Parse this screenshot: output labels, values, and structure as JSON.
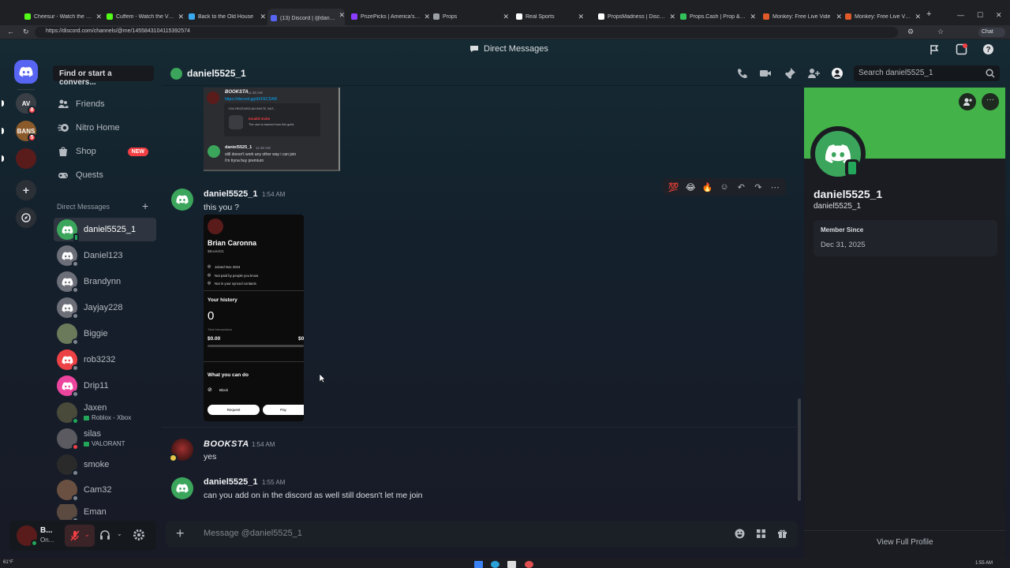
{
  "browser": {
    "tabs": [
      {
        "label": "Cheesur - Watch the VOD o",
        "color": "#53fc18"
      },
      {
        "label": "Cuffem - Watch the VOD on",
        "color": "#53fc18"
      },
      {
        "label": "Back to the Old House",
        "color": "#3aa8f0"
      },
      {
        "label": "(13) Discord | @daniel5525",
        "color": "#5865f2"
      },
      {
        "label": "PrizePicks | America's #1 Fan",
        "color": "#8b3dff"
      },
      {
        "label": "Props",
        "color": "#9aa0a6"
      },
      {
        "label": "Real Sports",
        "color": "#ffffff"
      },
      {
        "label": "PropsMadness | Discover N",
        "color": "#ffffff"
      },
      {
        "label": "Props.Cash | Prop & Pick Fi",
        "color": "#33c15a"
      },
      {
        "label": "Monkey: Free Live Vide",
        "color": "#e05a2a"
      },
      {
        "label": "Monkey: Free Live Vide",
        "color": "#e05a2a"
      }
    ],
    "url": "https://discord.com/channels/@me/1455843104115392574",
    "chat_label": "Chat"
  },
  "app": {
    "title": "Direct Messages",
    "servers": [
      {
        "abbr": "AV",
        "badge": "8",
        "color": "#3a3f46"
      },
      {
        "abbr": "BANS",
        "badge": "5",
        "color": "#8a5a2a"
      },
      {
        "abbr": "",
        "badge": "",
        "color": "#5a1b1b"
      }
    ]
  },
  "sidebar": {
    "search": "Find or start a convers...",
    "nav": [
      {
        "label": "Friends",
        "icon": "friends-icon"
      },
      {
        "label": "Nitro Home",
        "icon": "nitro-icon"
      },
      {
        "label": "Shop",
        "icon": "shop-icon",
        "badge": "NEW"
      },
      {
        "label": "Quests",
        "icon": "quests-icon"
      }
    ],
    "dm_header": "Direct Messages",
    "dms": [
      {
        "name": "daniel5525_1",
        "color": "#3ba55c",
        "status": "mobile"
      },
      {
        "name": "Daniel123",
        "color": "#6d6f78",
        "status": "offline"
      },
      {
        "name": "Brandynn",
        "color": "#6d6f78",
        "status": "offline"
      },
      {
        "name": "Jayjay228",
        "color": "#6d6f78",
        "status": "offline"
      },
      {
        "name": "Biggie",
        "color": "#6a7a5a",
        "status": "offline"
      },
      {
        "name": "rob3232",
        "color": "#ed4245",
        "status": "offline"
      },
      {
        "name": "Drip11",
        "color": "#eb459e",
        "status": "offline"
      },
      {
        "name": "Jaxen",
        "sub": "Roblox - Xbox",
        "color": "#4a4a3a",
        "status": "online"
      },
      {
        "name": "silas",
        "sub": "VALORANT",
        "color": "#5a5a60",
        "status": "dnd"
      },
      {
        "name": "smoke",
        "color": "#2a2a2a",
        "status": "offline"
      },
      {
        "name": "Cam32",
        "color": "#6a5040",
        "status": "offline"
      },
      {
        "name": "Eman",
        "color": "#5a4a40",
        "status": "offline"
      }
    ],
    "user": {
      "name": "B...",
      "status": "On..."
    }
  },
  "chat": {
    "recipient": "daniel5525_1",
    "search_placeholder": "Search daniel5525_1",
    "embed1": {
      "author": "BOOKSTA",
      "time": "11:48 AM",
      "link": "https://discord.gg/dXFECDAR",
      "invite_label": "YOU RECEIVED AN INVITE, BUT...",
      "invalid_title": "Invalid Invite",
      "invalid_desc": "The user is banned from this guild.",
      "reply_author": "daniel5525_1",
      "reply_time": "11:48 AM",
      "reply_line1": "still doesn't work any other way i can join",
      "reply_line2": "i'm tryna buy premium"
    },
    "messages": [
      {
        "author": "daniel5525_1",
        "time": "1:54 AM",
        "text": "this you ?"
      },
      {
        "author": "BOOKSTA",
        "time": "1:54 AM",
        "text": "yes"
      },
      {
        "author": "daniel5525_1",
        "time": "1:55 AM",
        "text": "can you add on in the discord as well still doesn't let me join"
      }
    ],
    "embed2": {
      "name": "Brian Caronna",
      "handle": "$Booksl31",
      "items": [
        "Joined Nov 2024",
        "Not paid by people you know",
        "Not in your synced contacts"
      ],
      "history_title": "Your history",
      "history_count": "0",
      "history_sub": "Total transactions",
      "amount_left": "$0.00",
      "amount_right": "$0",
      "what_title": "What you can do",
      "block": "Block",
      "request": "Request",
      "pay": "Pay"
    },
    "toolbar_emojis": [
      "💯",
      "😂",
      "🔥"
    ],
    "composer_placeholder": "Message @daniel5525_1"
  },
  "profile": {
    "display_name": "daniel5525_1",
    "username": "daniel5525_1",
    "member_since_label": "Member Since",
    "member_since": "Dec 31, 2025",
    "view_full": "View Full Profile",
    "banner_color": "#43b349"
  },
  "taskbar": {
    "weather": "61°F",
    "time": "1:55 AM"
  }
}
